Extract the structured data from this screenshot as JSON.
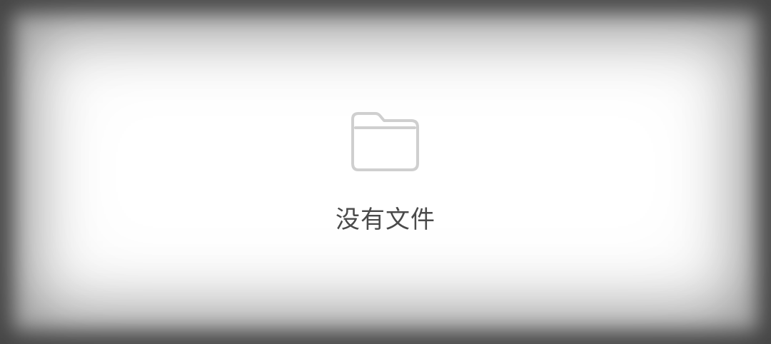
{
  "empty_state": {
    "icon": "folder-icon",
    "message": "没有文件"
  },
  "colors": {
    "icon_stroke": "#cfcfcf",
    "text": "#4a4a4a",
    "background": "#ffffff",
    "vignette": "#5f5f5f"
  }
}
